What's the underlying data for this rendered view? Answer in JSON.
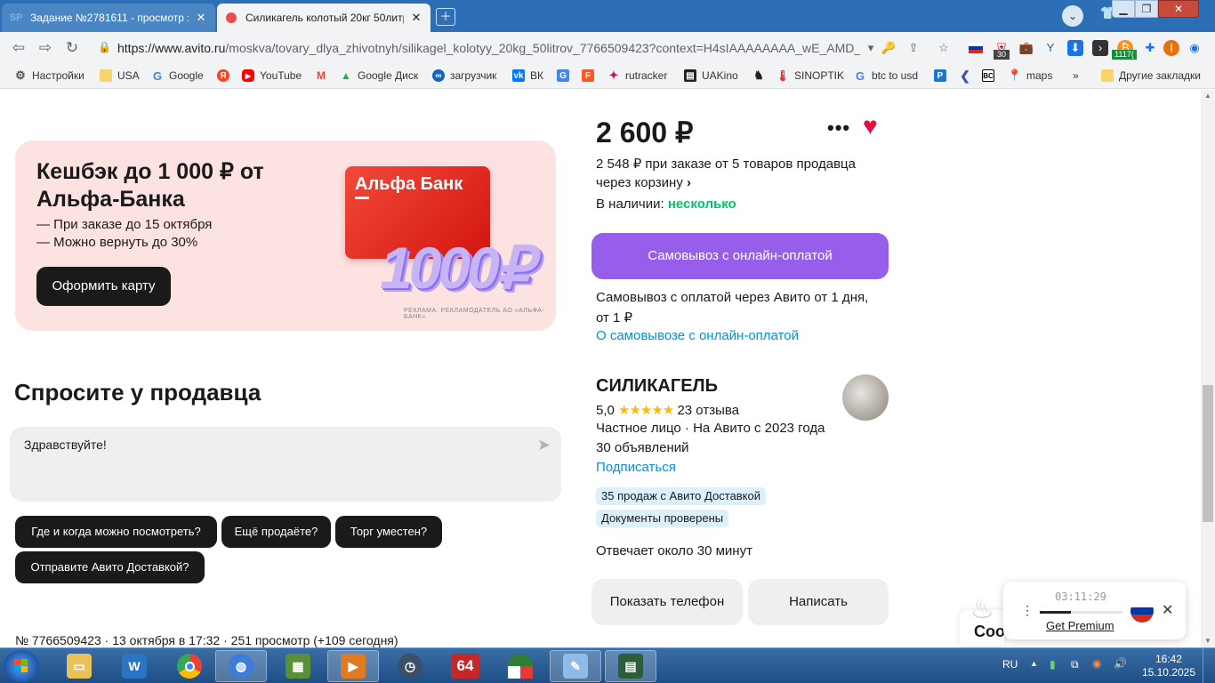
{
  "browser": {
    "tabs": [
      {
        "label": "Задание №2781611 - просмотр з...",
        "favicon": "SP",
        "active": false
      },
      {
        "label": "Силикагель колотый 20кг 50литр...",
        "favicon": "avito-icon",
        "active": true
      }
    ],
    "profile_initial": "",
    "url_host": "https://www.avito.ru",
    "url_path": "/moskva/tovary_dlya_zhivotnyh/silikagel_kolotyy_20kg_50litrov_7766509423?context=H4sIAAAAAAAA_wE_AMD_...",
    "counter_badge": "30",
    "ext_badge": "1117(",
    "bookmarks": [
      {
        "label": "Настройки",
        "icon": "gear-icon"
      },
      {
        "label": "USA",
        "icon": "folder-icon"
      },
      {
        "label": "Google",
        "icon": "google-icon"
      },
      {
        "label": "",
        "icon": "yandex-icon"
      },
      {
        "label": "YouTube",
        "icon": "youtube-icon"
      },
      {
        "label": "",
        "icon": "gmail-icon"
      },
      {
        "label": "Google Диск",
        "icon": "drive-icon"
      },
      {
        "label": "загрузчик",
        "icon": "infinity-icon"
      },
      {
        "label": "ВК",
        "icon": "vk-icon"
      },
      {
        "label": "",
        "icon": "translate-icon"
      },
      {
        "label": "",
        "icon": "f-icon"
      },
      {
        "label": "rutracker",
        "icon": "rutracker-icon"
      },
      {
        "label": "UAKino",
        "icon": "uakino-icon"
      },
      {
        "label": "",
        "icon": "figure-icon"
      },
      {
        "label": "SINOPTIK",
        "icon": "thermometer-icon"
      },
      {
        "label": "btc to usd",
        "icon": "google-icon"
      },
      {
        "label": "",
        "icon": "p-icon"
      },
      {
        "label": "",
        "icon": "arrow-icon"
      },
      {
        "label": "",
        "icon": "bc-icon"
      },
      {
        "label": "maps",
        "icon": "maps-icon"
      }
    ],
    "bookmarks_more": "»",
    "other_bookmarks": "Другие закладки"
  },
  "promo": {
    "title": "Кешбэк до 1 000 ₽ от Альфа-Банка",
    "line1": "— При заказе до 15 октября",
    "line2": "— Можно вернуть до 30%",
    "button": "Оформить карту",
    "card_bank": "Альфа Банк",
    "big_number": "1000₽",
    "ad_note": "РЕКЛАМА. РЕКЛАМОДАТЕЛЬ АО «АЛЬФА-БАНК»"
  },
  "ask": {
    "title": "Спросите у продавца",
    "message": "Здравствуйте!",
    "chips": [
      "Где и когда можно посмотреть?",
      "Ещё продаёте?",
      "Торг уместен?",
      "Отправите Авито Доставкой?"
    ]
  },
  "meta": "№ 7766509423 · 13 октября в 17:32 · 251 просмотр (+109 сегодня)",
  "product": {
    "price": "2 600 ₽",
    "bulk_line1": "2 548 ₽ при заказе от 5 товаров продавца",
    "bulk_line2": "через корзину",
    "stock_label": "В наличии:",
    "stock_value": "несколько",
    "buy_button": "Самовывоз с онлайн-оплатой",
    "pickup_line1": "Самовывоз с оплатой через Авито от 1 дня,",
    "pickup_line2": "от 1 ₽",
    "pickup_link": "О самовывозе с онлайн-оплатой"
  },
  "seller": {
    "name": "СИЛИКАГЕЛЬ",
    "rating": "5,0",
    "stars": "★★★★★",
    "reviews": "23 отзыва",
    "type": "Частное лицо · На Авито с 2023 года",
    "ads": "30 объявлений",
    "subscribe": "Подписаться",
    "tag1": "35 продаж с Авито Доставкой",
    "tag2": "Документы проверены",
    "response": "Отвечает около 30 минут",
    "phone_button": "Показать телефон",
    "write_button": "Написать"
  },
  "widget": {
    "time": "03:11:29",
    "progress": 0.38,
    "premium": "Get Premium"
  },
  "cookie_text": "Coo",
  "taskbar": {
    "lang": "RU",
    "time": "16:42",
    "date": "15.10.2025",
    "apps": [
      "explorer-icon",
      "shield-icon",
      "chrome-icon",
      "globe-icon",
      "calc-icon",
      "media-icon",
      "clock-icon",
      "64-icon",
      "umbrella-icon",
      "notepad-icon",
      "monitor-icon"
    ],
    "app64_label": "64"
  },
  "colors": {
    "accent_purple": "#965eeb",
    "link_blue": "#0091de",
    "green": "#02c36a",
    "heart_red": "#e0123c"
  }
}
